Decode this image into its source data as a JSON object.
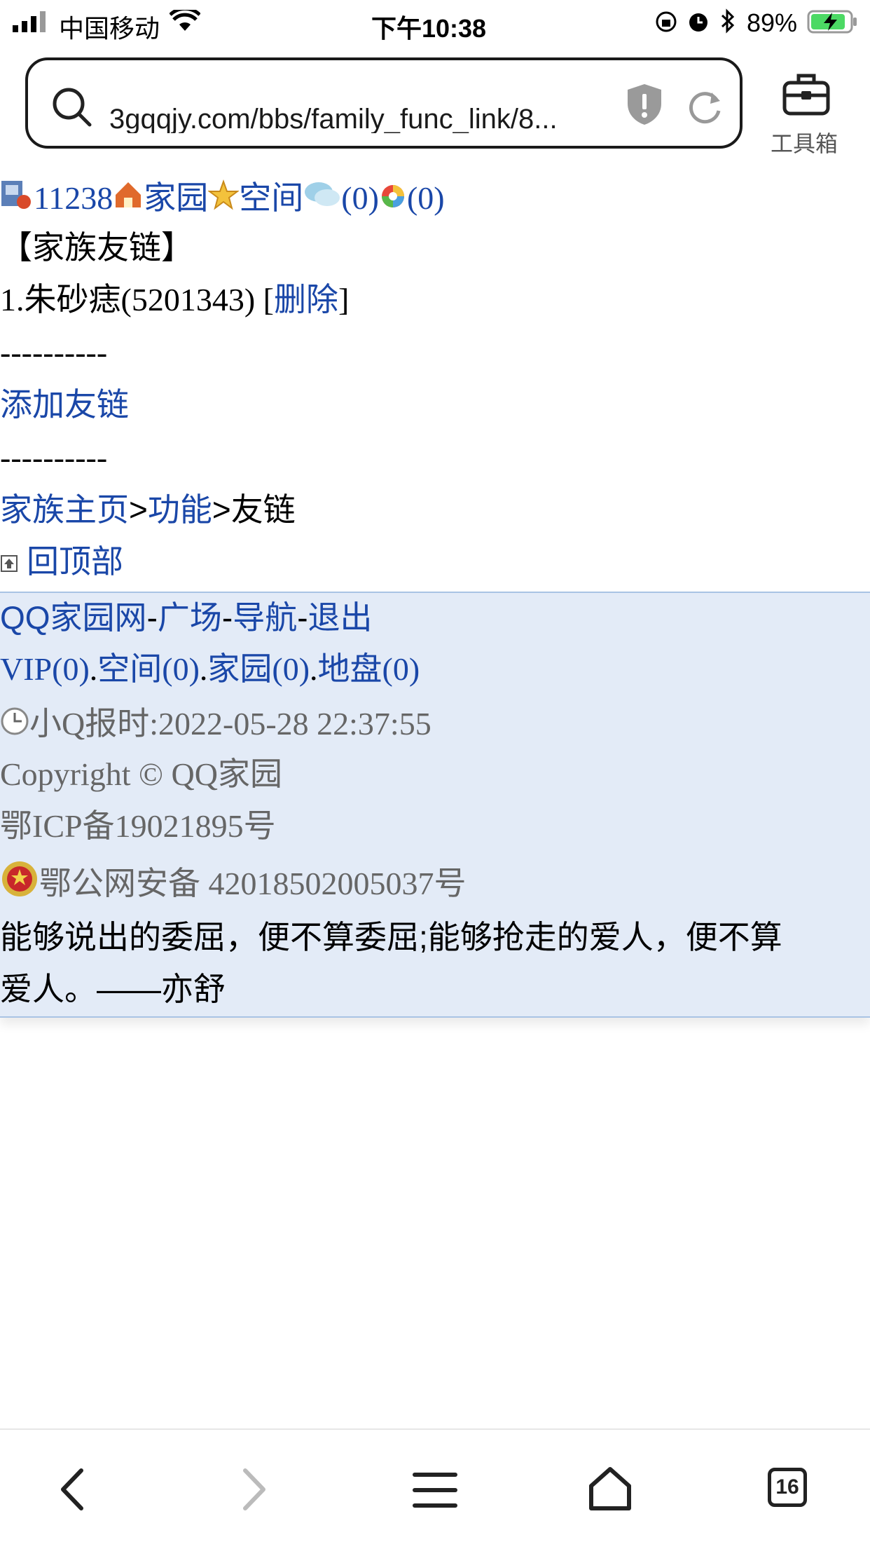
{
  "status_bar": {
    "carrier": "中国移动",
    "time": "下午10:38",
    "battery": "89%"
  },
  "browser": {
    "url": "3gqqjy.com/bbs/family_func_link/8...",
    "toolbox_label": "工具箱",
    "tab_count": "16"
  },
  "top_links": {
    "user_id": "11238",
    "home": "家园",
    "space": "空间",
    "messages": "(0)",
    "notices": "(0)"
  },
  "section_title": "【家族友链】",
  "link_item": {
    "text": "1.朱砂痣(5201343) [",
    "delete": "删除",
    "close": "]"
  },
  "divider": "----------",
  "add_link": "添加友链",
  "breadcrumb": {
    "home": "家族主页",
    "sep1": ">",
    "functions": "功能",
    "sep2": ">",
    "current": "友链"
  },
  "back_to_top": "回顶部",
  "footer": {
    "nav": [
      "QQ家园网",
      "广场",
      "导航",
      "退出"
    ],
    "nav_sep": "-",
    "counts": [
      "VIP(0)",
      "空间(0)",
      "家园(0)",
      "地盘(0)"
    ],
    "counts_sep": ".",
    "clock": "小Q报时:2022-05-28 22:37:55",
    "copyright": "Copyright © QQ家园",
    "icp": "鄂ICP备19021895号",
    "police": "鄂公网安备 42018502005037号",
    "quote_line1": "能够说出的委屈，便不算委屈;能够抢走的爱人，便不算",
    "quote_line2": "爱人。——亦舒"
  },
  "colors": {
    "link": "#1a47a8",
    "footer_bg": "#e3ebf7",
    "footer_border": "#a9c3e4",
    "gray_text": "#666666"
  }
}
